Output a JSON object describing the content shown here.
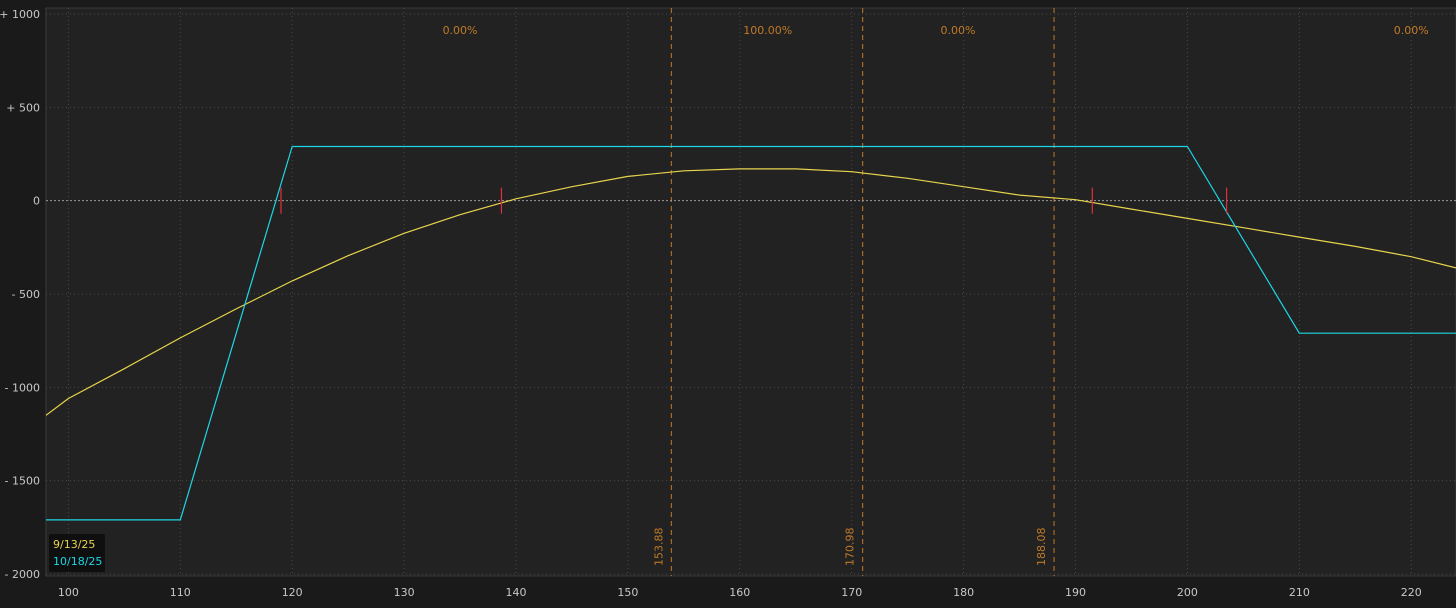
{
  "chart_data": {
    "type": "line",
    "title": "",
    "xlabel": "",
    "ylabel": "",
    "xlim": [
      98,
      224
    ],
    "ylim": [
      -2000,
      1000
    ],
    "x_ticks": [
      100,
      110,
      120,
      130,
      140,
      150,
      160,
      170,
      180,
      190,
      200,
      210,
      220
    ],
    "x_tick_labels": [
      "100",
      "110",
      "120",
      "130",
      "140",
      "150",
      "160",
      "170",
      "180",
      "190",
      "200",
      "210",
      "220"
    ],
    "y_ticks": [
      1000,
      500,
      0,
      -500,
      -1000,
      -1500,
      -2000
    ],
    "y_tick_labels": [
      "+ 1000",
      "+ 500",
      "0",
      "- 500",
      "- 1000",
      "- 1500",
      "- 2000"
    ],
    "grid": true,
    "zero_line": true,
    "legend_position": "bottom-left",
    "series": [
      {
        "name": "9/13/25",
        "color": "#e8d44d",
        "points": [
          [
            98,
            -1150
          ],
          [
            100,
            -1060
          ],
          [
            105,
            -900
          ],
          [
            110,
            -735
          ],
          [
            115,
            -580
          ],
          [
            120,
            -430
          ],
          [
            125,
            -295
          ],
          [
            130,
            -175
          ],
          [
            135,
            -75
          ],
          [
            140,
            10
          ],
          [
            145,
            75
          ],
          [
            150,
            130
          ],
          [
            155,
            160
          ],
          [
            160,
            170
          ],
          [
            165,
            170
          ],
          [
            170,
            155
          ],
          [
            175,
            120
          ],
          [
            180,
            75
          ],
          [
            185,
            30
          ],
          [
            190,
            5
          ],
          [
            195,
            -45
          ],
          [
            200,
            -95
          ],
          [
            205,
            -145
          ],
          [
            210,
            -195
          ],
          [
            215,
            -245
          ],
          [
            220,
            -300
          ],
          [
            224,
            -360
          ]
        ]
      },
      {
        "name": "10/18/25",
        "color": "#1dd7e6",
        "points": [
          [
            98,
            -1710
          ],
          [
            110,
            -1710
          ],
          [
            120,
            290
          ],
          [
            200,
            290
          ],
          [
            210,
            -710
          ],
          [
            211,
            -710
          ],
          [
            224,
            -710
          ]
        ]
      }
    ],
    "reference_lines": [
      {
        "x": 153.88,
        "label": "153.88"
      },
      {
        "x": 170.98,
        "label": "170.98"
      },
      {
        "x": 188.08,
        "label": "188.08"
      }
    ],
    "zone_labels": [
      {
        "x": 135,
        "text": "0.00%"
      },
      {
        "x": 162.5,
        "text": "100.00%"
      },
      {
        "x": 179.5,
        "text": "0.00%"
      },
      {
        "x": 220,
        "text": "0.00%"
      }
    ],
    "breakeven_markers": [
      {
        "x": 119,
        "series": "10/18/25"
      },
      {
        "x": 138.7,
        "series": "9/13/25"
      },
      {
        "x": 191.5,
        "series": "9/13/25"
      },
      {
        "x": 203.5,
        "series": "10/18/25"
      }
    ]
  }
}
